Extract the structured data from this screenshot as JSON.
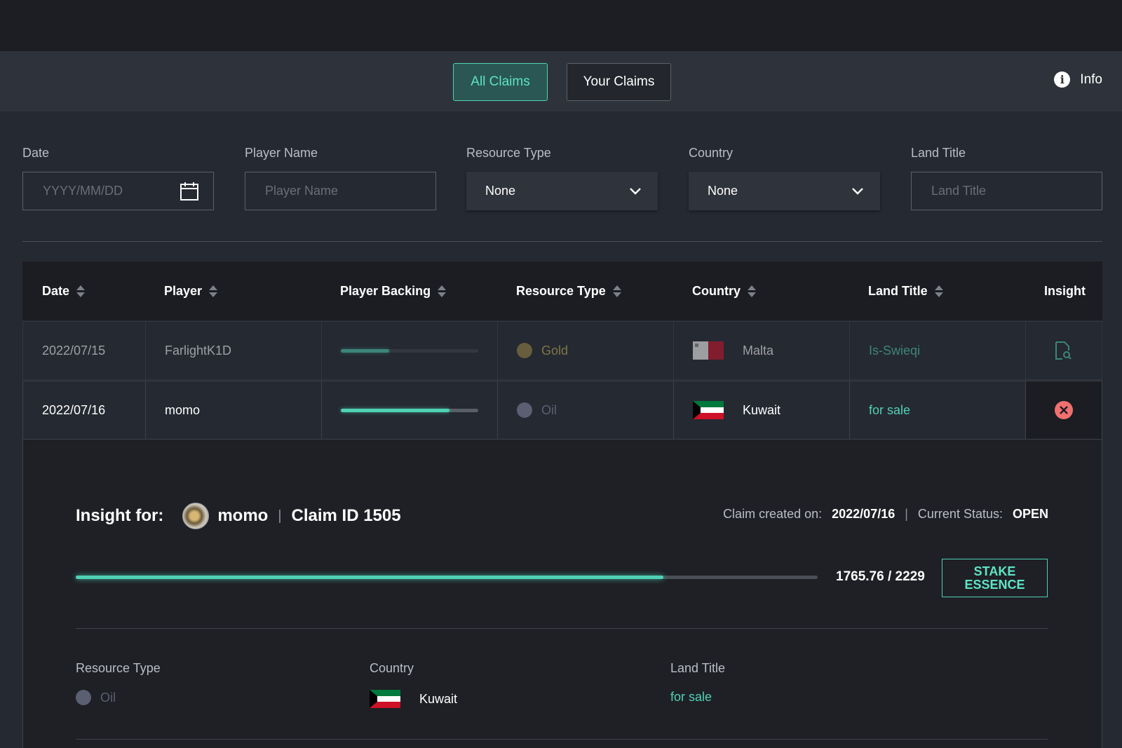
{
  "tabs": {
    "all_claims": "All Claims",
    "your_claims": "Your Claims"
  },
  "info": {
    "label": "Info",
    "icon": "info-icon"
  },
  "filters": {
    "date": {
      "label": "Date",
      "placeholder": "YYYY/MM/DD",
      "icon": "calendar-icon"
    },
    "player_name": {
      "label": "Player Name",
      "placeholder": "Player Name"
    },
    "resource_type": {
      "label": "Resource Type",
      "value": "None"
    },
    "country": {
      "label": "Country",
      "value": "None"
    },
    "land_title": {
      "label": "Land Title",
      "placeholder": "Land Title"
    }
  },
  "table": {
    "columns": [
      "Date",
      "Player",
      "Player Backing",
      "Resource Type",
      "Country",
      "Land Title",
      "Insight"
    ],
    "rows": [
      {
        "date": "2022/07/15",
        "player": "FarlightK1D",
        "backing": 0.35,
        "resource": "Gold",
        "resource_color": "#9c8a45",
        "country": "Malta",
        "land_title": "Is-Swieqi",
        "insight_icon": "document-search-icon"
      },
      {
        "date": "2022/07/16",
        "player": "momo",
        "backing": 0.79,
        "resource": "Oil",
        "resource_color": "#5a6072",
        "country": "Kuwait",
        "land_title": "for sale",
        "insight_icon": "close-circle-icon"
      }
    ]
  },
  "insight": {
    "title": "Insight for:",
    "player": "momo",
    "claim": "Claim ID 1505",
    "created_label": "Claim created on:",
    "created_value": "2022/07/16",
    "status_label": "Current Status:",
    "status_value": "OPEN",
    "progress": 0.792,
    "progress_text": "1765.76 / 2229",
    "stake_line1": "STAKE",
    "stake_line2": "ESSENCE",
    "details": {
      "resource_label": "Resource Type",
      "resource_value": "Oil",
      "country_label": "Country",
      "country_value": "Kuwait",
      "land_label": "Land Title",
      "land_value": "for sale"
    }
  },
  "colors": {
    "accent": "#4fd1b5",
    "background": "#252932",
    "close_red": "#f07070"
  }
}
